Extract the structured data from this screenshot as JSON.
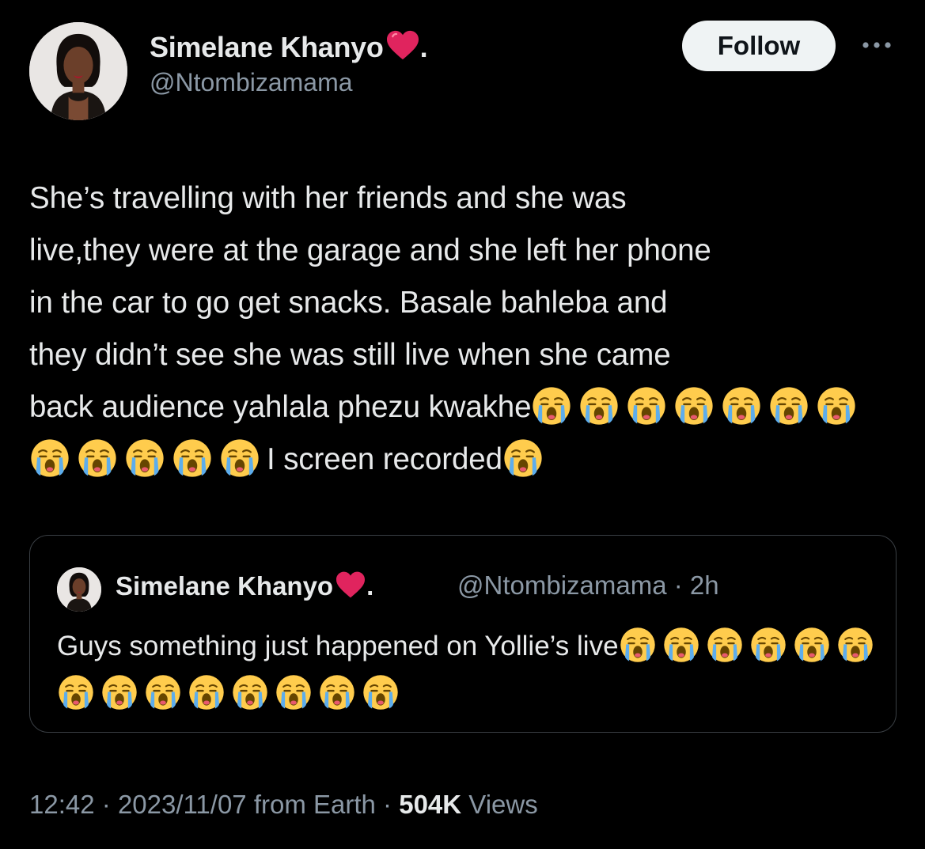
{
  "author": {
    "display_name": "Simelane Khanyo",
    "name_suffix": ".",
    "handle": "@Ntombizamama",
    "avatar_icon": "profile-photo",
    "heart_icon": "red-heart-emoji"
  },
  "actions": {
    "follow_label": "Follow",
    "more_icon": "ellipsis-icon"
  },
  "tweet": {
    "text_parts": [
      "She’s travelling with her friends and she was\nlive,they were at the garage and she left her phone\nin the car to go get snacks. Basale bahleba and\nthey didn’t see she was still live when she came\nback audience yahlala phezu kwakhe",
      "I screen recorded"
    ],
    "emoji_name": "loudly-crying-face-emoji",
    "emoji_run_1": 12,
    "emoji_run_2": 1
  },
  "quoted_tweet": {
    "display_name": "Simelane Khanyo",
    "name_suffix": ".",
    "handle": "@Ntombizamama",
    "separator": "·",
    "time_ago": "2h",
    "text": "Guys something just happened on Yollie’s live",
    "emoji_count": 14
  },
  "meta": {
    "time": "12:42",
    "separator": "·",
    "date": "2023/11/07",
    "source": "from Earth",
    "views_count": "504K",
    "views_label": "Views"
  },
  "colors": {
    "background": "#000000",
    "text_primary": "#e7e9ea",
    "text_secondary": "#8b98a5",
    "follow_bg": "#eff3f4",
    "border": "#3a3f44",
    "heart": "#e0245e",
    "emoji_face": "#ffcc4d",
    "emoji_tears": "#5dadec"
  }
}
